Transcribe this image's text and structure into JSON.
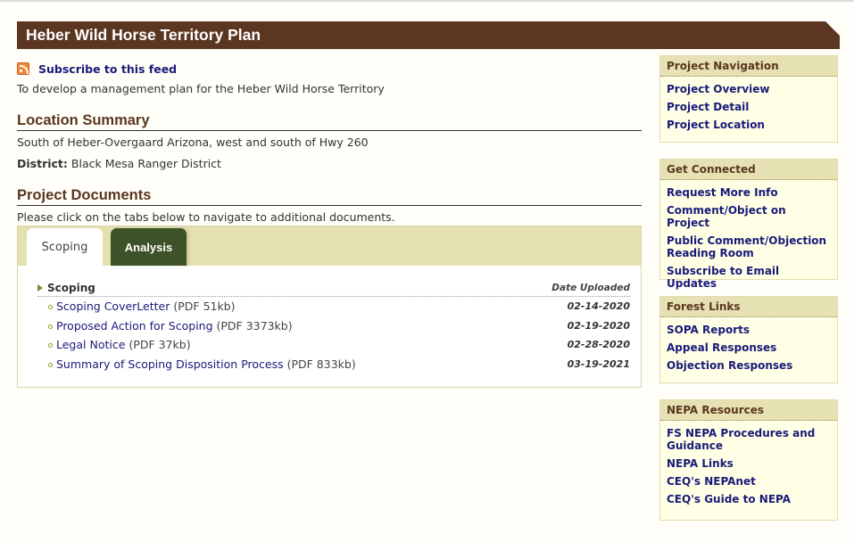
{
  "page": {
    "title": "Heber Wild Horse Territory Plan",
    "subscribe_label": "Subscribe to this feed",
    "description": "To develop a management plan for the Heber Wild Horse Territory"
  },
  "location": {
    "heading": "Location Summary",
    "text": "South of Heber-Overgaard Arizona, west and south of Hwy 260",
    "district_label": "District:",
    "district_value": "Black Mesa Ranger District"
  },
  "documents": {
    "heading": "Project Documents",
    "note": "Please click on the tabs below to navigate to additional documents.",
    "tabs": [
      {
        "label": "Scoping",
        "active": true
      },
      {
        "label": "Analysis",
        "active": false
      }
    ],
    "section_title": "Scoping",
    "date_header": "Date Uploaded",
    "items": [
      {
        "name": "Scoping CoverLetter",
        "meta": "(PDF 51kb)",
        "date": "02-14-2020"
      },
      {
        "name": "Proposed Action for Scoping",
        "meta": "(PDF 3373kb)",
        "date": "02-19-2020"
      },
      {
        "name": "Legal Notice",
        "meta": "(PDF 37kb)",
        "date": "02-28-2020"
      },
      {
        "name": "Summary of Scoping Disposition Process",
        "meta": "(PDF 833kb)",
        "date": "03-19-2021"
      }
    ]
  },
  "sidebar": {
    "project_navigation": {
      "title": "Project Navigation",
      "links": [
        "Project Overview",
        "Project Detail",
        "Project Location"
      ]
    },
    "get_connected": {
      "title": "Get Connected",
      "links": [
        "Request More Info",
        "Comment/Object on Project",
        "Public Comment/Objection Reading Room",
        "Subscribe to Email Updates"
      ]
    },
    "forest_links": {
      "title": "Forest Links",
      "links": [
        "SOPA Reports",
        "Appeal Responses",
        "Objection Responses"
      ]
    },
    "nepa_resources": {
      "title": "NEPA Resources",
      "links": [
        "FS NEPA Procedures and Guidance",
        "NEPA Links",
        "CEQ's NEPAnet",
        "CEQ's Guide to NEPA"
      ]
    }
  },
  "colors": {
    "title_bar": "#5b3620",
    "tab_active_bg": "#ffffff",
    "tab_inactive_bg": "#3d5228",
    "link": "#1a1a7a",
    "sidebar_head_bg": "#e5e1b2",
    "sidebar_bg": "#ffffe6"
  }
}
